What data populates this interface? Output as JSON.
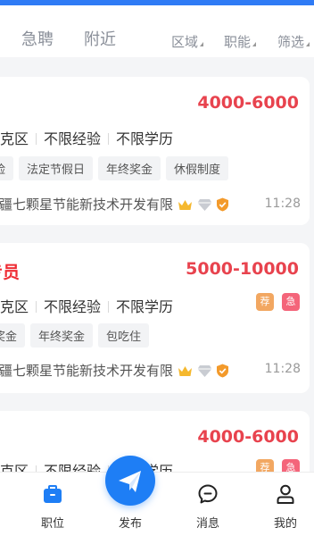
{
  "tabs": [
    {
      "label": "急聘"
    },
    {
      "label": "附近"
    }
  ],
  "filters": [
    {
      "label": "区域"
    },
    {
      "label": "职能"
    },
    {
      "label": "筛选"
    }
  ],
  "jobs": [
    {
      "title": "",
      "salary": "4000-6000",
      "location": "尼克区",
      "experience": "不限经验",
      "education": "不限学历",
      "tags": [
        "险",
        "法定节假日",
        "年终奖金",
        "休假制度"
      ],
      "company": "新疆七颗星节能新技术开发有限",
      "time": "11:28",
      "flags": []
    },
    {
      "title": "专员",
      "salary": "5000-10000",
      "location": "尼克区",
      "experience": "不限经验",
      "education": "不限学历",
      "tags": [
        "奖金",
        "年终奖金",
        "包吃住"
      ],
      "company": "新疆七颗星节能新技术开发有限",
      "time": "11:28",
      "flags": [
        "荐",
        "急"
      ]
    },
    {
      "title": "",
      "salary": "4000-6000",
      "location": "尼克区",
      "experience": "不限经验",
      "education": "不限学历",
      "flags": [
        "荐",
        "急"
      ]
    }
  ],
  "bottom_nav": [
    {
      "label": "职位",
      "icon": "briefcase-icon"
    },
    {
      "label": "发布",
      "icon": "paper-plane-icon"
    },
    {
      "label": "消息",
      "icon": "chat-bubble-icon"
    },
    {
      "label": "我的",
      "icon": "person-icon"
    }
  ],
  "colors": {
    "accent": "#1e7ef5",
    "salary": "#e8434e",
    "title": "#ef2c34"
  }
}
